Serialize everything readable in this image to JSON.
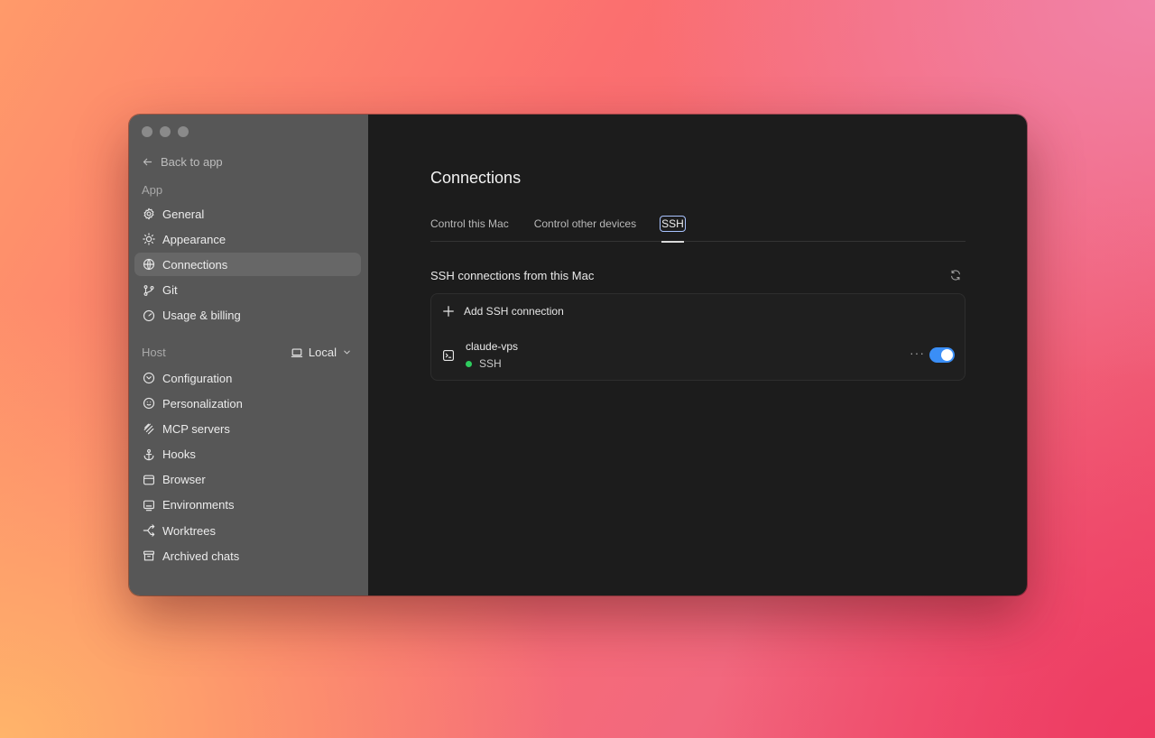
{
  "sidebar": {
    "back_label": "Back to app",
    "app_section_label": "App",
    "app_items": [
      {
        "label": "General",
        "icon": "gear-icon"
      },
      {
        "label": "Appearance",
        "icon": "sun-icon"
      },
      {
        "label": "Connections",
        "icon": "globe-icon",
        "active": true
      },
      {
        "label": "Git",
        "icon": "git-branch-icon"
      },
      {
        "label": "Usage & billing",
        "icon": "gauge-icon"
      }
    ],
    "host_section_label": "Host",
    "host_select_value": "Local",
    "host_items": [
      {
        "label": "Configuration",
        "icon": "config-icon"
      },
      {
        "label": "Personalization",
        "icon": "personalization-icon"
      },
      {
        "label": "MCP servers",
        "icon": "mcp-icon"
      },
      {
        "label": "Hooks",
        "icon": "anchor-icon"
      },
      {
        "label": "Browser",
        "icon": "browser-icon"
      },
      {
        "label": "Environments",
        "icon": "environment-icon"
      },
      {
        "label": "Worktrees",
        "icon": "worktree-icon"
      },
      {
        "label": "Archived chats",
        "icon": "archive-icon"
      }
    ]
  },
  "main": {
    "title": "Connections",
    "tabs": [
      {
        "label": "Control this Mac",
        "active": false
      },
      {
        "label": "Control other devices",
        "active": false
      },
      {
        "label": "SSH",
        "active": true
      }
    ],
    "section_title": "SSH connections from this Mac",
    "add_label": "Add SSH connection",
    "connections": [
      {
        "name": "claude-vps",
        "status": "SSH",
        "status_color": "#2ecc5e",
        "enabled": true
      }
    ]
  },
  "colors": {
    "accent": "#3a8ef6",
    "sidebar_bg": "#575757",
    "main_bg": "#1c1c1c"
  }
}
